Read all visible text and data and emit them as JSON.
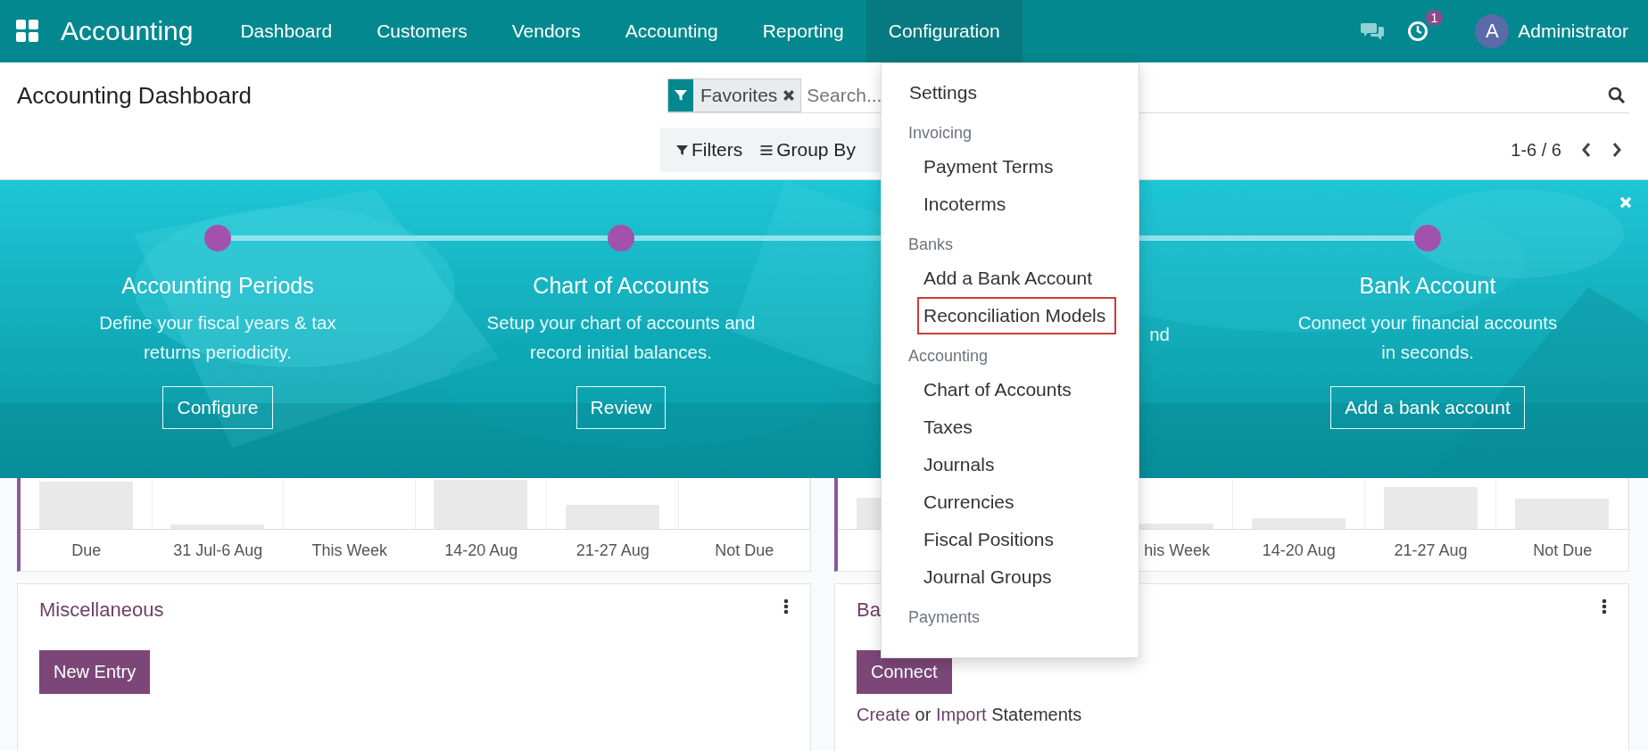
{
  "navbar": {
    "app_name": "Accounting",
    "menu": [
      {
        "label": "Dashboard",
        "selected": false
      },
      {
        "label": "Customers",
        "selected": false
      },
      {
        "label": "Vendors",
        "selected": false
      },
      {
        "label": "Accounting",
        "selected": false
      },
      {
        "label": "Reporting",
        "selected": false
      },
      {
        "label": "Configuration",
        "selected": true
      }
    ],
    "activity_count": "1",
    "user": {
      "avatar_letter": "A",
      "name": "Administrator"
    }
  },
  "control_panel": {
    "title": "Accounting Dashboard",
    "facets": [
      {
        "label": "Favorites"
      }
    ],
    "search": {
      "placeholder": "Search..."
    },
    "buttons": [
      "Filters",
      "Group By"
    ],
    "pager": "1-6 / 6"
  },
  "onboarding": {
    "steps": [
      {
        "kind": "step",
        "title": "Accounting Periods",
        "description": [
          "Define your fiscal years & tax",
          "returns periodicity."
        ],
        "button": "Configure"
      },
      {
        "kind": "step",
        "title": "Chart of Accounts",
        "description": [
          "Setup your chart of accounts and",
          "record initial balances."
        ],
        "button": "Review"
      },
      {
        "kind": "covered",
        "fragment": "nd"
      },
      {
        "kind": "step",
        "title": "Bank Account",
        "description": [
          "Connect your financial accounts",
          "in seconds."
        ],
        "button": "Add a bank account"
      }
    ]
  },
  "chart_cards": [
    {
      "labels": [
        {
          "kind": "label",
          "text": "Due"
        },
        {
          "kind": "label",
          "text": "31 Jul-6 Aug"
        },
        {
          "kind": "label",
          "text": "This Week"
        },
        {
          "kind": "label",
          "text": "14-20 Aug"
        },
        {
          "kind": "label",
          "text": "21-27 Aug"
        },
        {
          "kind": "label",
          "text": "Not Due"
        }
      ]
    },
    {
      "labels": [
        {
          "kind": "covered"
        },
        {
          "kind": "covered"
        },
        {
          "kind": "label",
          "text": "his Week"
        },
        {
          "kind": "label",
          "text": "14-20 Aug"
        },
        {
          "kind": "label",
          "text": "21-27 Aug"
        },
        {
          "kind": "label",
          "text": "Not Due"
        }
      ]
    }
  ],
  "journal_cards": [
    {
      "title": "Miscellaneous",
      "button": "New Entry"
    },
    {
      "title": "Ba",
      "button": "Connect",
      "links_line": [
        {
          "kind": "link",
          "text": "Create"
        },
        {
          "kind": "text",
          "text": "or"
        },
        {
          "kind": "link",
          "text": "Import"
        },
        {
          "kind": "text",
          "text": "Statements"
        }
      ]
    }
  ],
  "dropdown": {
    "entries": [
      {
        "kind": "item",
        "label": "Settings",
        "highlighted": false
      },
      {
        "kind": "header",
        "label": "Invoicing"
      },
      {
        "kind": "subitem",
        "label": "Payment Terms",
        "highlighted": false
      },
      {
        "kind": "subitem",
        "label": "Incoterms",
        "highlighted": false
      },
      {
        "kind": "header",
        "label": "Banks"
      },
      {
        "kind": "subitem",
        "label": "Add a Bank Account",
        "highlighted": false
      },
      {
        "kind": "subitem",
        "label": "Reconciliation Models",
        "highlighted": true
      },
      {
        "kind": "header",
        "label": "Accounting"
      },
      {
        "kind": "subitem",
        "label": "Chart of Accounts",
        "highlighted": false
      },
      {
        "kind": "subitem",
        "label": "Taxes",
        "highlighted": false
      },
      {
        "kind": "subitem",
        "label": "Journals",
        "highlighted": false
      },
      {
        "kind": "subitem",
        "label": "Currencies",
        "highlighted": false
      },
      {
        "kind": "subitem",
        "label": "Fiscal Positions",
        "highlighted": false
      },
      {
        "kind": "subitem",
        "label": "Journal Groups",
        "highlighted": false
      },
      {
        "kind": "header",
        "label": "Payments"
      }
    ]
  }
}
